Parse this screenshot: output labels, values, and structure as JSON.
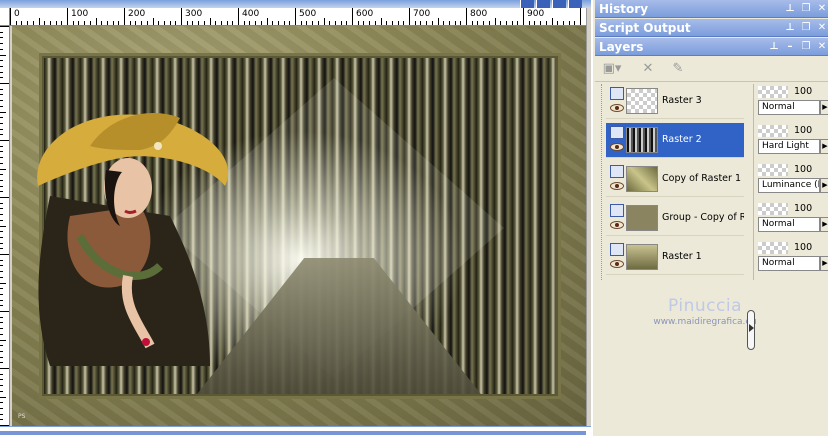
{
  "canvas": {
    "ruler_labels": [
      "0",
      "100",
      "200",
      "300",
      "400",
      "500",
      "600",
      "700",
      "800",
      "900"
    ],
    "signature": "PS"
  },
  "panels": {
    "history": {
      "title": "History"
    },
    "script_output": {
      "title": "Script Output"
    },
    "layers": {
      "title": "Layers",
      "layers": [
        {
          "name": "Raster 3",
          "opacity": "100",
          "blend_mode": "Normal",
          "selected": false
        },
        {
          "name": "Raster 2",
          "opacity": "100",
          "blend_mode": "Hard Light",
          "selected": true
        },
        {
          "name": "Copy of Raster 1",
          "opacity": "100",
          "blend_mode": "Luminance (L)",
          "selected": false
        },
        {
          "name": "Group - Copy of R",
          "opacity": "100",
          "blend_mode": "Normal",
          "selected": false
        },
        {
          "name": "Raster 1",
          "opacity": "100",
          "blend_mode": "Normal",
          "selected": false
        }
      ]
    }
  },
  "watermark": {
    "name": "Pinuccia",
    "url": "www.maidiregrafica.eu"
  },
  "colors": {
    "panel_title": "#7b9ddc",
    "selection": "#3163c6",
    "background": "#ece9d8"
  }
}
